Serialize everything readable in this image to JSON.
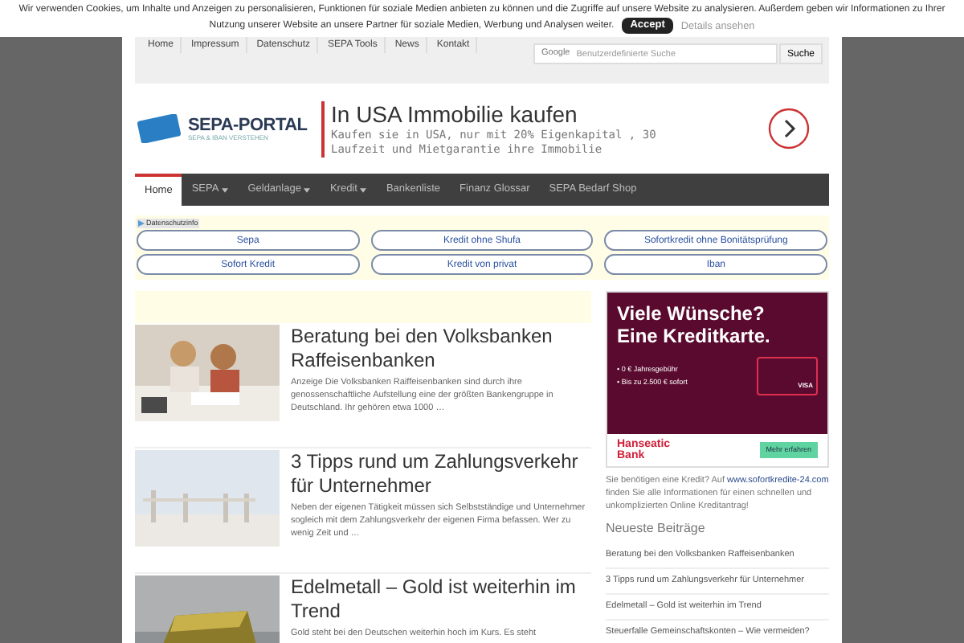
{
  "cookie_bar": {
    "lines": [
      "Wir verwenden Cookies, um Inhalte und Anzeigen zu personalisieren, Funktionen für soziale Medien anbieten zu können und die Zugriffe auf unsere Website zu analysieren. Außerdem geben wir Informationen zu Ihrer",
      "Nutzung unserer Website an unsere Partner für soziale Medien, Werbung und Analysen weiter."
    ],
    "accept": "Accept",
    "details": "Details ansehen"
  },
  "top_nav": {
    "items": [
      "Home",
      "Impressum",
      "Datenschutz",
      "SEPA Tools",
      "News",
      "Kontakt"
    ],
    "search": {
      "brand": "Google",
      "placeholder": "Benutzerdefinierte Suche",
      "button": "Suche"
    }
  },
  "logo": {
    "title": "SEPA-PORTAL",
    "tagline": "SEPA & IBAN VERSTEHEN"
  },
  "ad": {
    "title": "In USA Immobilie kaufen",
    "text": "Kaufen sie in USA, nur mit 20% Eigenkapital , 30 Laufzeit und Mietgarantie ihre Immobilie"
  },
  "main_nav": [
    {
      "label": "Home",
      "selected": true,
      "dropdown": false
    },
    {
      "label": "SEPA",
      "selected": false,
      "dropdown": true
    },
    {
      "label": "Geldanlage",
      "selected": false,
      "dropdown": true
    },
    {
      "label": "Kredit",
      "selected": false,
      "dropdown": true
    },
    {
      "label": "Bankenliste",
      "selected": false,
      "dropdown": false
    },
    {
      "label": "Finanz Glossar",
      "selected": false,
      "dropdown": false
    },
    {
      "label": "SEPA Bedarf Shop",
      "selected": false,
      "dropdown": false
    }
  ],
  "privacy_label": "Datenschutzinfo",
  "link_buttons": [
    "Sepa",
    "Kredit ohne Shufa",
    "Sofortkredit ohne Bonitätsprüfung",
    "Sofort Kredit",
    "Kredit von privat",
    "Iban"
  ],
  "articles": [
    {
      "title": "Beratung bei den Volksbanken Raffeisenbanken",
      "excerpt": "Anzeige Die Volksbanken Raiffeisenbanken sind durch ihre genossenschaftliche Aufstellung eine der größten Bankengruppe in Deutschland. Ihr gehören etwa 1000 …"
    },
    {
      "title": "3 Tipps rund um Zahlungsverkehr für Unternehmer",
      "excerpt": "Neben der eigenen Tätigkeit müssen sich Selbstständige und Unternehmer sogleich mit dem Zahlungsverkehr der eigenen Firma befassen. Wer zu wenig Zeit und …"
    },
    {
      "title": "Edelmetall – Gold ist weiterhin im Trend",
      "excerpt": "Gold steht bei den Deutschen weiterhin hoch im Kurs. Es steht"
    }
  ],
  "sidebar": {
    "ad": {
      "headline": [
        "Viele Wünsche?",
        "Eine Kreditkarte."
      ],
      "bullets": [
        "• 0 € Jahresgebühr",
        "• Bis zu  2.500 € sofort"
      ],
      "card_label": "VISA",
      "bank": [
        "Hanseatic",
        "Bank"
      ],
      "cta": "Mehr erfahren"
    },
    "promo": {
      "before": "Sie benötigen eine Kredit? Auf ",
      "link": "www.sofortkredite-24.com",
      "after": " finden Sie alle Informationen für einen schnellen und unkomplizierten Online Kreditantrag!"
    },
    "recent_heading": "Neueste Beiträge",
    "recent_posts": [
      "Beratung bei den Volksbanken Raffeisenbanken",
      "3 Tipps rund um Zahlungsverkehr für Unternehmer",
      "Edelmetall – Gold ist weiterhin im Trend",
      "Steuerfalle Gemeinschaftskonten – Wie vermeiden?"
    ]
  }
}
